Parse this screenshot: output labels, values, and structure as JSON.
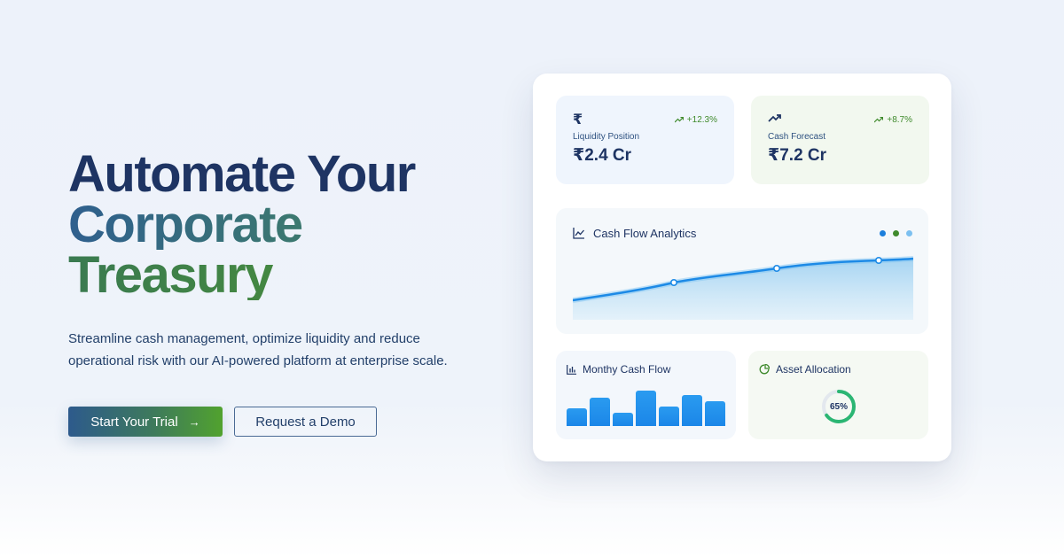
{
  "hero": {
    "headline_line1": "Automate Your",
    "headline_line2": "Corporate",
    "headline_line3": "Treasury",
    "subtext": "Streamline cash management, optimize liquidity and reduce operational risk with our AI-powered platform at enterprise scale.",
    "primary_cta": "Start Your Trial",
    "primary_cta_icon": "arrow-right-icon",
    "secondary_cta": "Request a Demo"
  },
  "dashboard": {
    "liquidity": {
      "icon": "rupee-icon",
      "change": "+12.3%",
      "label": "Liquidity Position",
      "value": "₹2.4 Cr"
    },
    "forecast": {
      "icon": "trend-up-icon",
      "change": "+8.7%",
      "label": "Cash Forecast",
      "value": "₹7.2 Cr"
    },
    "analytics": {
      "title": "Cash Flow Analytics",
      "icon": "line-chart-icon",
      "legend_colors": [
        "#1c7fdc",
        "#3f8a2c",
        "#7cc0f0"
      ]
    },
    "monthly": {
      "title": "Monthy Cash Flow",
      "icon": "bar-chart-icon",
      "bar_values": [
        20,
        32,
        15,
        40,
        22,
        35,
        28
      ]
    },
    "allocation": {
      "title": "Asset Allocation",
      "icon": "pie-chart-icon",
      "percent": 65,
      "percent_label": "65%"
    },
    "colors": {
      "accent_blue": "#1c7fdc",
      "accent_green": "#3f8a2c",
      "navy": "#1e3463"
    }
  }
}
